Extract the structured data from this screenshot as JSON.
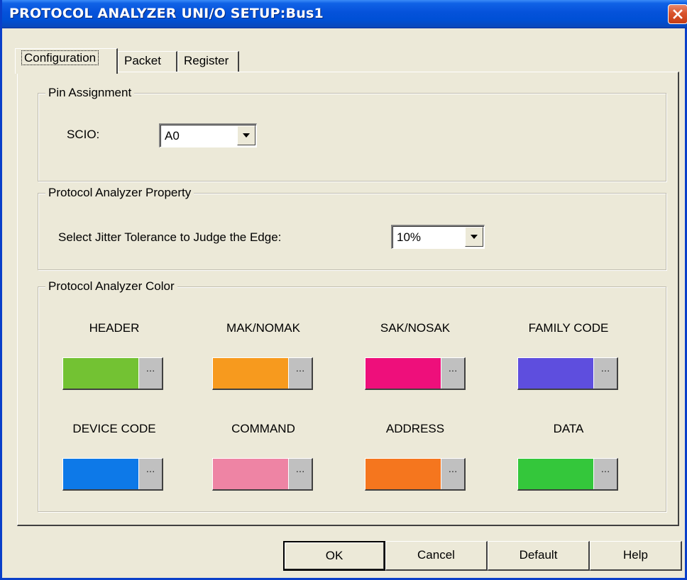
{
  "window": {
    "title": "PROTOCOL ANALYZER UNI/O SETUP:Bus1"
  },
  "tabs": [
    {
      "label": "Configuration",
      "active": true
    },
    {
      "label": "Packet",
      "active": false
    },
    {
      "label": "Register",
      "active": false
    }
  ],
  "pin_assignment": {
    "legend": "Pin Assignment",
    "scio_label": "SCIO:",
    "scio_value": "A0"
  },
  "property": {
    "legend": "Protocol Analyzer Property",
    "jitter_label": "Select Jitter Tolerance to Judge the Edge:",
    "jitter_value": "10%"
  },
  "color_group": {
    "legend": "Protocol Analyzer Color",
    "items": [
      {
        "label": "HEADER",
        "color": "#73c233"
      },
      {
        "label": "MAK/NOMAK",
        "color": "#f79a1e"
      },
      {
        "label": "SAK/NOSAK",
        "color": "#ee0f7b"
      },
      {
        "label": "FAMILY CODE",
        "color": "#5e4ede"
      },
      {
        "label": "DEVICE CODE",
        "color": "#0d79e8"
      },
      {
        "label": "COMMAND",
        "color": "#ee84a4"
      },
      {
        "label": "ADDRESS",
        "color": "#f5761e"
      },
      {
        "label": "DATA",
        "color": "#34c73b"
      }
    ],
    "picker_glyph": "..."
  },
  "buttons": {
    "ok": "OK",
    "cancel": "Cancel",
    "default": "Default",
    "help": "Help"
  }
}
